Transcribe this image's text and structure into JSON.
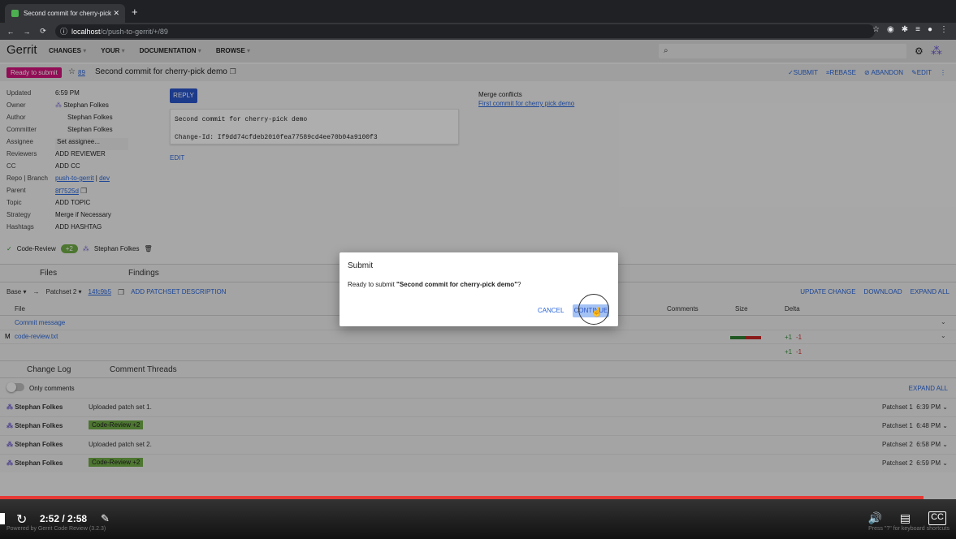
{
  "browser": {
    "tab_title": "Second commit for cherry-pick",
    "url_host": "localhost",
    "url_path": "/c/push-to-gerrit/+/89"
  },
  "gerrit": {
    "logo": "Gerrit",
    "nav": [
      "CHANGES",
      "YOUR",
      "DOCUMENTATION",
      "BROWSE"
    ]
  },
  "change": {
    "status": "Ready to submit",
    "number": "89",
    "subject": "Second commit for cherry-pick demo",
    "actions": [
      "SUBMIT",
      "REBASE",
      "ABANDON",
      "EDIT"
    ],
    "meta": {
      "updated_label": "Updated",
      "updated": "6:59 PM",
      "owner_label": "Owner",
      "owner": "Stephan Folkes",
      "author_label": "Author",
      "author": "Stephan Folkes",
      "committer_label": "Committer",
      "committer": "Stephan Folkes",
      "assignee_label": "Assignee",
      "assignee_placeholder": "Set assignee...",
      "reviewers_label": "Reviewers",
      "reviewers": "ADD REVIEWER",
      "cc_label": "CC",
      "cc": "ADD CC",
      "repo_label": "Repo | Branch",
      "repo": "push-to-gerrit",
      "branch": "dev",
      "parent_label": "Parent",
      "parent": "8f7525d",
      "topic_label": "Topic",
      "topic": "ADD TOPIC",
      "strategy_label": "Strategy",
      "strategy": "Merge if Necessary",
      "hashtags_label": "Hashtags",
      "hashtags": "ADD HASHTAG"
    },
    "reply": "REPLY",
    "commit_line1": "Second commit for cherry-pick demo",
    "commit_line2": "Change-Id: If9dd74cfdeb2010fea77589cd4ee70b04a9100f3",
    "edit": "EDIT",
    "merge_conflicts_label": "Merge conflicts",
    "merge_conflict_link": "First commit for cherry pick demo",
    "code_review_label": "Code-Review",
    "code_review_vote": "+2",
    "code_review_user": "Stephan Folkes"
  },
  "files": {
    "tabs": [
      "Files",
      "Findings"
    ],
    "base": "Base",
    "patchset": "Patchset 2",
    "commit_hash": "14fc9b5",
    "add_desc": "ADD PATCHSET DESCRIPTION",
    "right_actions": [
      "UPDATE CHANGE",
      "DOWNLOAD",
      "EXPAND ALL"
    ],
    "headers": {
      "file": "File",
      "comments": "Comments",
      "size": "Size",
      "delta": "Delta"
    },
    "commit_message": "Commit message",
    "rows": [
      {
        "status": "M",
        "name": "code-review.txt",
        "plus": "+1",
        "minus": "-1"
      }
    ],
    "total_plus": "+1",
    "total_minus": "-1"
  },
  "log": {
    "tabs": [
      "Change Log",
      "Comment Threads"
    ],
    "only_comments": "Only comments",
    "expand_all": "EXPAND ALL",
    "entries": [
      {
        "who": "Stephan Folkes",
        "msg": "Uploaded patch set 1.",
        "ps": "Patchset 1",
        "time": "6:39 PM"
      },
      {
        "who": "Stephan Folkes",
        "vote": "Code-Review +2",
        "ps": "Patchset 1",
        "time": "6:48 PM"
      },
      {
        "who": "Stephan Folkes",
        "msg": "Uploaded patch set 2.",
        "ps": "Patchset 2",
        "time": "6:58 PM"
      },
      {
        "who": "Stephan Folkes",
        "vote": "Code-Review +2",
        "ps": "Patchset 2",
        "time": "6:59 PM"
      }
    ]
  },
  "dialog": {
    "title": "Submit",
    "text_prefix": "Ready to submit ",
    "text_subject": "\"Second commit for cherry-pick demo\"",
    "text_suffix": "?",
    "cancel": "CANCEL",
    "continue": "CONTINUE"
  },
  "video": {
    "time": "2:52 / 2:58",
    "progress": 0.966,
    "footer_left": "Powered by Gerrit Code Review (3.2.3)",
    "footer_right": "Press \"?\" for keyboard shortcuts"
  }
}
